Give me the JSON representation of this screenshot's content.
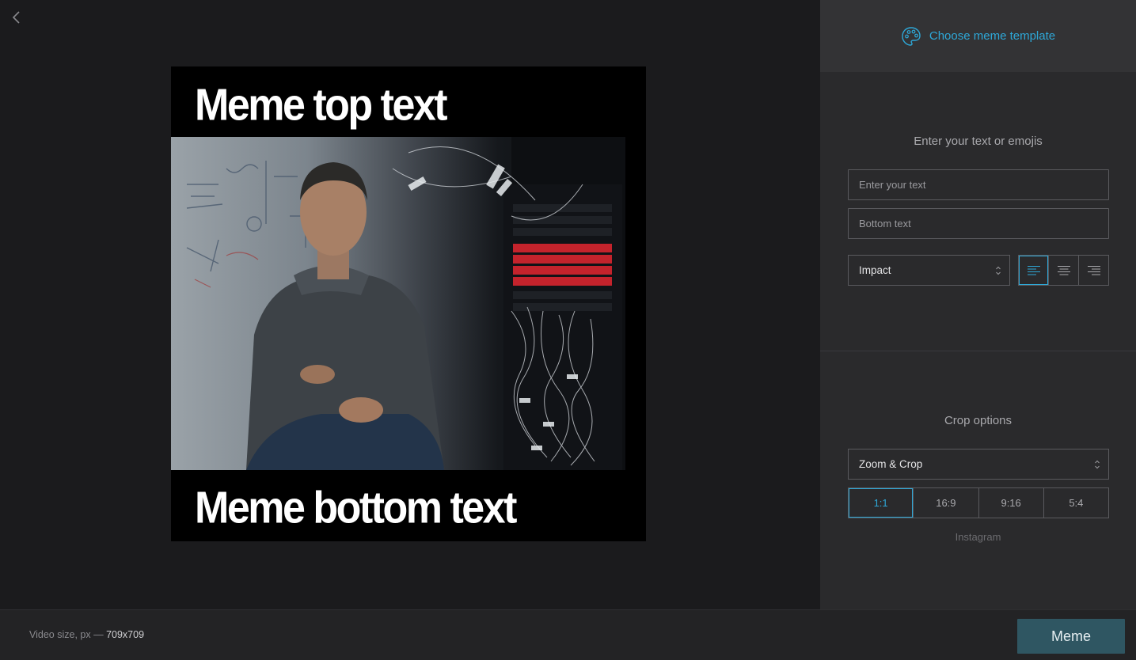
{
  "preview": {
    "top_text": "Meme top text",
    "bottom_text": "Meme bottom text"
  },
  "panel": {
    "template_button_label": "Choose meme template",
    "text_section_title": "Enter your text or emojis",
    "top_text_placeholder": "Enter your text",
    "bottom_text_placeholder": "Bottom text",
    "font_select_value": "Impact",
    "alignment_options": [
      "left",
      "center",
      "right"
    ],
    "alignment_selected": "left",
    "crop_section_title": "Crop options",
    "crop_mode_value": "Zoom & Crop",
    "ratios": [
      "1:1",
      "16:9",
      "9:16",
      "5:4"
    ],
    "ratio_selected": "1:1",
    "ratio_caption": "Instagram"
  },
  "footer": {
    "size_label": "Video size, px",
    "size_separator": "—",
    "size_value": "709x709",
    "export_label": "Meme"
  },
  "colors": {
    "accent": "#2ea8d8",
    "export_button": "#2f5662",
    "background": "#1b1b1d",
    "panel": "#2a2a2c"
  },
  "icons": {
    "back": "chevron-left-icon",
    "template": "palette-icon",
    "caret": "select-caret-icon"
  }
}
